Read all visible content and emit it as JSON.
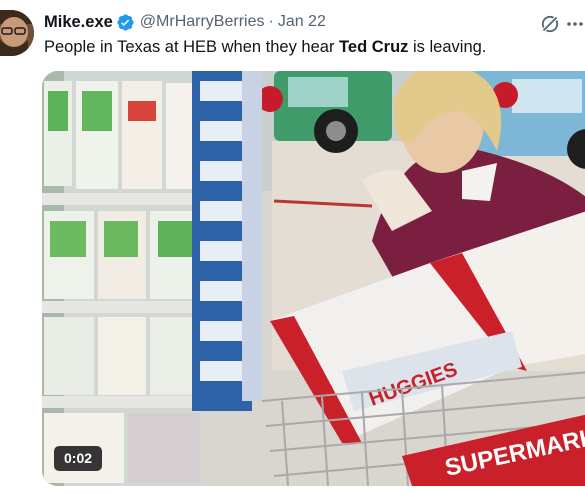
{
  "tweet": {
    "display_name": "Mike.exe",
    "handle": "@MrHarryBerries",
    "separator": "·",
    "date": "Jan 22",
    "text_before": "People in Texas at HEB when they hear ",
    "text_bold": "Ted Cruz",
    "text_after": " is leaving.",
    "verified": true
  },
  "media": {
    "duration": "0:02",
    "overlay_text": "SUPERMARK",
    "package_text": "HUGGIES"
  },
  "icons": {
    "verified": "verified-badge-icon",
    "grok": "grok-icon",
    "more": "more-options-icon"
  },
  "colors": {
    "verified_blue": "#1d9bf0",
    "secondary_text": "#536471",
    "primary_text": "#0f1419"
  }
}
